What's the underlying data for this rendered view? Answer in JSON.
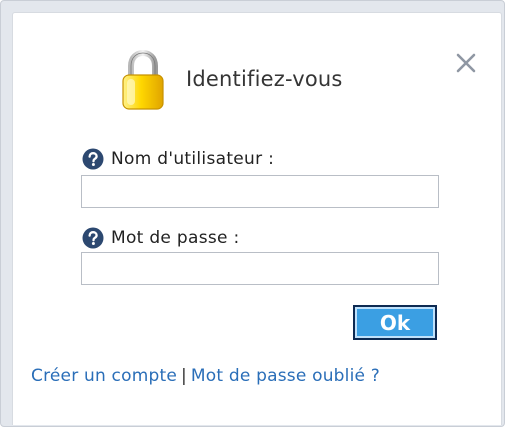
{
  "dialog": {
    "title": "Identifiez-vous",
    "close_icon": "close-icon",
    "lock_icon": "padlock-icon"
  },
  "form": {
    "username": {
      "label": "Nom d'utilisateur :",
      "value": "",
      "help_icon": "help-icon"
    },
    "password": {
      "label": "Mot de passe :",
      "value": "",
      "help_icon": "help-icon"
    },
    "submit_label": "Ok"
  },
  "footer": {
    "create_account": "Créer un compte",
    "separator": "|",
    "forgot_password": "Mot de passe oublié ?"
  },
  "colors": {
    "button_fill": "#3b9fe3",
    "button_border": "#0d2a52",
    "link": "#2a6eb8",
    "help_icon": "#2c4870",
    "lock": "#f2c200"
  }
}
